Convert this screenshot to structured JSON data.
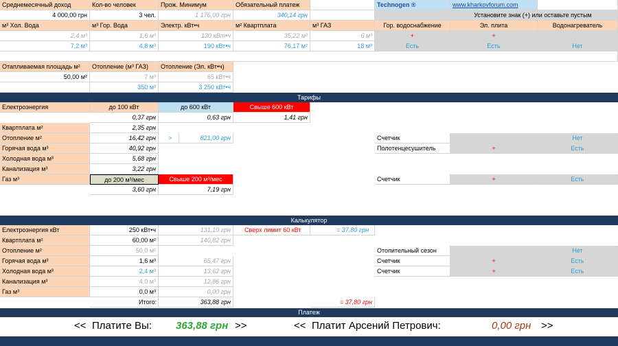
{
  "header": {
    "income_label": "Среднемесячный доход",
    "people_label": "Кол-во человек",
    "min_label": "Прож. Минимум",
    "payment_label": "Обязательный платеж",
    "brand": "Technogen ®",
    "site": "www.kharkovforum.com",
    "income": "4 000,00 грн",
    "people": "3 чел.",
    "min": "1 176,00 грн",
    "payment": "340,14 грн",
    "hint": "Установите знак (+) или оставьте пустым"
  },
  "meters": {
    "labels": [
      "м³ Хол. Вода",
      "м³ Гор. Вода",
      "Электр. кВт•ч",
      "м² Квартплата",
      "м³ ГАЗ"
    ],
    "norm": [
      "2,4 м³",
      "1,6 м³",
      "130 кВт•ч",
      "35,22 м²",
      "6 м³"
    ],
    "fact": [
      "7,2 м³",
      "4,8 м³",
      "190 кВт•ч",
      "76,17 м²",
      "18 м³"
    ],
    "opt_labels": [
      "Гор. водоснабжение",
      "Эл. плита",
      "Водонагреватель"
    ],
    "opt_marks": [
      "+",
      "+",
      ""
    ],
    "opt_values": [
      "Есть",
      "Есть",
      "Нет"
    ]
  },
  "heating": {
    "area_label": "Отапливаемая площадь м²",
    "gas_label": "Отопление (м³ ГАЗ)",
    "el_label": "Отопление (Эл. кВт•ч)",
    "area": "50,00 м²",
    "gas_norm": "7 м³",
    "el_norm": "65 кВт•ч",
    "gas": "350 м³",
    "el": "3 250 кВт•ч"
  },
  "tariffs": {
    "title": "Тарифы",
    "el_label": "Електроэнергия",
    "tier1": "до 100  кВт",
    "tier2": "до 600  кВт",
    "tier3": "Свыше 600  кВт",
    "p1": "0,37 грн",
    "p2": "0,63 грн",
    "p3": "1,41 грн",
    "rows": [
      {
        "label": "Квартплата м²",
        "value": "2,35 грн"
      },
      {
        "label": "Отопление м²",
        "value": "16,42 грн"
      },
      {
        "label": "Горячая вода м³",
        "value": "40,92 грн"
      },
      {
        "label": "Холодная вода м³",
        "value": "5,68 грн"
      },
      {
        "label": "Канализация м³",
        "value": "3,22 грн"
      }
    ],
    "heat_gt": ">",
    "heat_alt": "821,00 грн",
    "gas_label": "Газ м³",
    "gas_t1": "до 200  м³/мес",
    "gas_t2": "Свыше 200  м³/мес",
    "gas_p1": "3,60 грн",
    "gas_p2": "7,19 грн",
    "counter_label": "Счетчик",
    "counter_value": "Нет",
    "towel_label": "Полотенцесушитель",
    "towel_mark": "+",
    "towel_value": "Есть",
    "gas_counter_label": "Счетчик",
    "gas_counter_mark": "+",
    "gas_counter_value": "Есть"
  },
  "calc": {
    "title": "Калькулятор",
    "rows": [
      {
        "label": "Електроэнергия кВт",
        "qty": "250 кВт•ч",
        "norm": "131,10 грн"
      },
      {
        "label": "Квартплата м²",
        "qty": "60,00 м²",
        "norm": "140,82 грн"
      },
      {
        "label": "Отопление м²",
        "qty": "50,0 м²",
        "norm": ""
      },
      {
        "label": "Горячая вода м³",
        "qty": "1,6 м³",
        "norm": "65,47 грн"
      },
      {
        "label": "Холодная вода м³",
        "qty": "2,4 м³",
        "norm": "13,62 грн"
      },
      {
        "label": "Канализация м³",
        "qty": "4,0 м³",
        "norm": "12,86 грн"
      },
      {
        "label": "Газ м³",
        "qty": "0,0 м³",
        "norm": "0,00 грн"
      }
    ],
    "over_label": "Сверх лимит 60  кВт",
    "over_value": "= 37,80 грн",
    "total_label": "Итого:",
    "total": "363,88 грн",
    "total_over": "= 37,80 грн",
    "season_label": "Отопительный сезон",
    "season_value": "Нет",
    "hw_label": "Счетчик",
    "hw_mark": "+",
    "hw_value": "Есть",
    "cw_label": "Счетчик",
    "cw_mark": "+",
    "cw_value": "Есть"
  },
  "payment": {
    "title": "Платеж",
    "you_label": "Платите Вы:",
    "you_value": "363,88 грн",
    "other_label": "Платит Арсений Петрович:",
    "other_value": "0,00 грн",
    "open": "<<",
    "close": ">>"
  },
  "colors": {
    "peach": "#fbd5b5",
    "navy": "#1f3a5c",
    "blue": "#2e9cd6",
    "red": "#ff0000",
    "green": "#2ea836",
    "brown": "#a03b12"
  }
}
